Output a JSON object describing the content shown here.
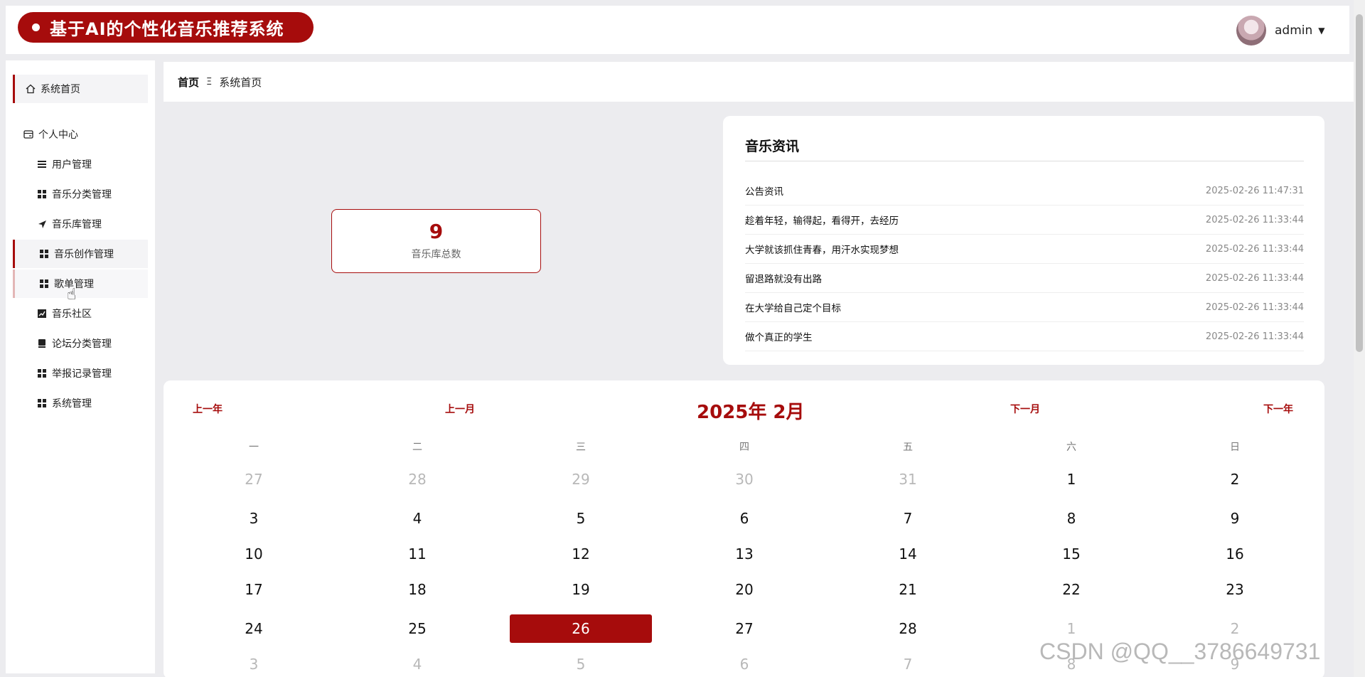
{
  "header": {
    "title": "基于AI的个性化音乐推荐系统",
    "username": "admin",
    "caret": "▼"
  },
  "sidebar": {
    "items": [
      {
        "label": "系统首页",
        "icon": "home-icon"
      },
      {
        "label": "个人中心",
        "icon": "card-icon"
      },
      {
        "label": "用户管理",
        "icon": "list-icon"
      },
      {
        "label": "音乐分类管理",
        "icon": "grid-icon"
      },
      {
        "label": "音乐库管理",
        "icon": "send-icon"
      },
      {
        "label": "音乐创作管理",
        "icon": "grid-icon"
      },
      {
        "label": "歌单管理",
        "icon": "grid-icon"
      },
      {
        "label": "音乐社区",
        "icon": "chart-icon"
      },
      {
        "label": "论坛分类管理",
        "icon": "book-icon"
      },
      {
        "label": "举报记录管理",
        "icon": "grid-icon"
      },
      {
        "label": "系统管理",
        "icon": "grid-icon"
      }
    ]
  },
  "breadcrumb": {
    "home": "首页",
    "separator": "Ξ",
    "current": "系统首页"
  },
  "stat": {
    "value": "9",
    "label": "音乐库总数"
  },
  "news": {
    "title": "音乐资讯",
    "items": [
      {
        "title": "公告资讯",
        "date": "2025-02-26 11:47:31"
      },
      {
        "title": "趁着年轻，输得起，看得开，去经历",
        "date": "2025-02-26 11:33:44"
      },
      {
        "title": "大学就该抓住青春，用汗水实现梦想",
        "date": "2025-02-26 11:33:44"
      },
      {
        "title": "留退路就没有出路",
        "date": "2025-02-26 11:33:44"
      },
      {
        "title": "在大学给自己定个目标",
        "date": "2025-02-26 11:33:44"
      },
      {
        "title": "做个真正的学生",
        "date": "2025-02-26 11:33:44"
      }
    ]
  },
  "calendar": {
    "prev_year": "上一年",
    "prev_month": "上一月",
    "title": "2025年 2月",
    "next_month": "下一月",
    "next_year": "下一年",
    "weekdays": [
      "一",
      "二",
      "三",
      "四",
      "五",
      "六",
      "日"
    ],
    "weeks": [
      [
        "27",
        "28",
        "29",
        "30",
        "31",
        "1",
        "2"
      ],
      [
        "3",
        "4",
        "5",
        "6",
        "7",
        "8",
        "9"
      ],
      [
        "10",
        "11",
        "12",
        "13",
        "14",
        "15",
        "16"
      ],
      [
        "17",
        "18",
        "19",
        "20",
        "21",
        "22",
        "23"
      ],
      [
        "24",
        "25",
        "26",
        "27",
        "28",
        "1",
        "2"
      ],
      [
        "3",
        "4",
        "5",
        "6",
        "7",
        "8",
        "9"
      ]
    ],
    "muted": [
      [
        true,
        true,
        true,
        true,
        true,
        false,
        false
      ],
      [
        false,
        false,
        false,
        false,
        false,
        false,
        false
      ],
      [
        false,
        false,
        false,
        false,
        false,
        false,
        false
      ],
      [
        false,
        false,
        false,
        false,
        false,
        false,
        false
      ],
      [
        false,
        false,
        false,
        false,
        false,
        true,
        true
      ],
      [
        true,
        true,
        true,
        true,
        true,
        true,
        true
      ]
    ],
    "today": "26"
  },
  "watermark": "CSDN @QQ__3786649731",
  "colors": {
    "accent": "#a60c0c",
    "background": "#ececef"
  }
}
